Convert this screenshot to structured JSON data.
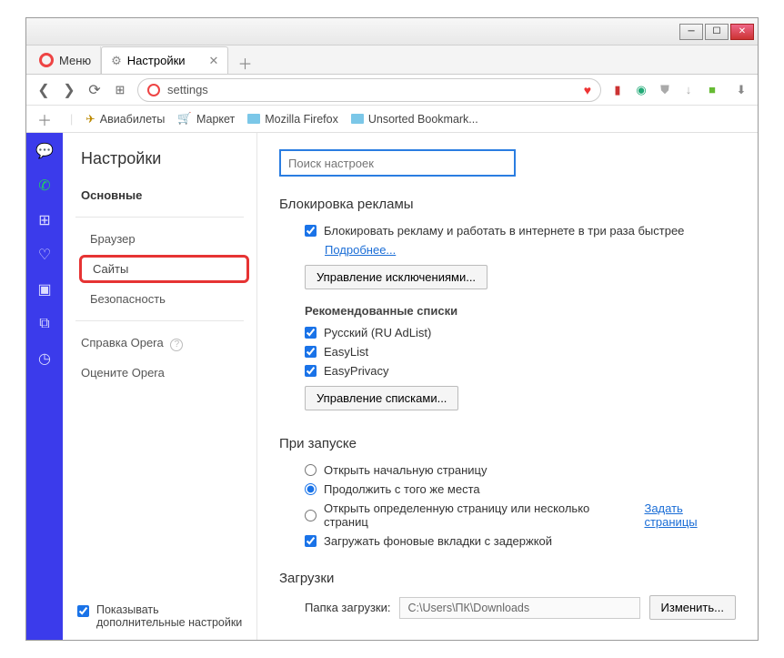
{
  "window": {
    "menu_label": "Меню"
  },
  "tab": {
    "title": "Настройки"
  },
  "address": {
    "value": "settings"
  },
  "bookmarks": {
    "items": [
      "Авиабилеты",
      "Маркет",
      "Mozilla Firefox",
      "Unsorted Bookmark..."
    ]
  },
  "settings_nav": {
    "title": "Настройки",
    "basic": "Основные",
    "browser": "Браузер",
    "sites": "Сайты",
    "security": "Безопасность",
    "help": "Справка Opera",
    "rate": "Оцените Opera",
    "advanced": "Показывать дополнительные настройки"
  },
  "search": {
    "placeholder": "Поиск настроек"
  },
  "adblock": {
    "heading": "Блокировка рекламы",
    "enable_label": "Блокировать рекламу и работать в интернете в три раза быстрее",
    "more": "Подробнее...",
    "manage_exceptions": "Управление исключениями...",
    "reco_heading": "Рекомендованные списки",
    "list_ru": "Русский (RU AdList)",
    "list_easy": "EasyList",
    "list_privacy": "EasyPrivacy",
    "manage_lists": "Управление списками..."
  },
  "startup": {
    "heading": "При запуске",
    "opt_start": "Открыть начальную страницу",
    "opt_continue": "Продолжить с того же места",
    "opt_specific": "Открыть определенную страницу или несколько страниц",
    "set_pages": "Задать страницы",
    "opt_lazy": "Загружать фоновые вкладки с задержкой"
  },
  "downloads": {
    "heading": "Загрузки",
    "folder_label": "Папка загрузки:",
    "folder_value": "C:\\Users\\ПК\\Downloads",
    "change": "Изменить..."
  }
}
